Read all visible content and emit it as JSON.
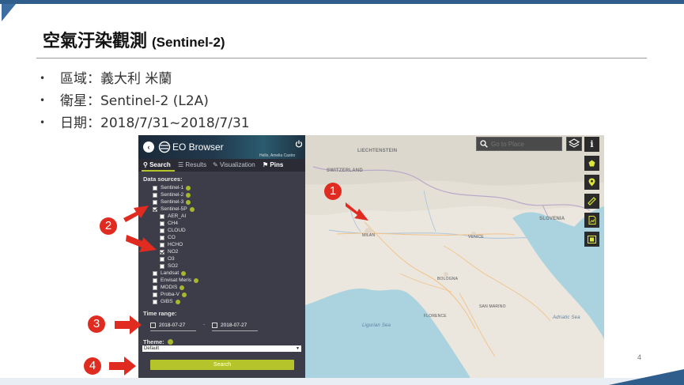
{
  "slide": {
    "title": "空氣汙染觀測",
    "title_sub": "(Sentinel-2)",
    "bullets": [
      "區域：義大利 米蘭",
      "衛星：Sentinel-2 (L2A)",
      "日期：2018/7/31~2018/7/31"
    ],
    "page_number": "4"
  },
  "annotations": [
    "1",
    "2",
    "3",
    "4"
  ],
  "eo_browser": {
    "brand": "EO Browser",
    "user": "Hello, Amelia Castro",
    "tabs": [
      "Search",
      "Results",
      "Visualization",
      "Pins"
    ],
    "data_sources_title": "Data sources:",
    "sources": [
      {
        "label": "Sentinel-1",
        "checked": false
      },
      {
        "label": "Sentinel-2",
        "checked": false
      },
      {
        "label": "Sentinel-3",
        "checked": false
      },
      {
        "label": "Sentinel-5P",
        "checked": true
      }
    ],
    "sub_sources": [
      {
        "label": "AER_AI",
        "checked": false
      },
      {
        "label": "CH4",
        "checked": false
      },
      {
        "label": "CLOUD",
        "checked": false
      },
      {
        "label": "CO",
        "checked": false
      },
      {
        "label": "HCHO",
        "checked": false
      },
      {
        "label": "NO2",
        "checked": true
      },
      {
        "label": "O3",
        "checked": false
      },
      {
        "label": "SO2",
        "checked": false
      }
    ],
    "more_sources": [
      {
        "label": "Landsat",
        "checked": false
      },
      {
        "label": "Envisat Meris",
        "checked": false
      },
      {
        "label": "MODIS",
        "checked": false
      },
      {
        "label": "Proba-V",
        "checked": false
      },
      {
        "label": "GIBS",
        "checked": false
      }
    ],
    "time_range_title": "Time range:",
    "date_from": "2018-07-27",
    "date_to": "2018-07-27",
    "theme_title": "Theme:",
    "theme_value": "Default",
    "search_button": "Search"
  },
  "map": {
    "goto_placeholder": "Go to Place",
    "labels": {
      "liechtenstein": "LIECHTENSTEIN",
      "switzerland": "SWITZERLAND",
      "slovenia": "SLOVENIA",
      "milan": "MILAN",
      "venice": "VENICE",
      "bologna": "BOLOGNA",
      "florence": "FLORENCE",
      "san_marino": "SAN MARINO",
      "adriatic": "Adriatic Sea",
      "ligurian": "Ligurian Sea"
    }
  },
  "colors": {
    "accent": "#b6c42b",
    "panel_bg": "#3c3d49",
    "annotation_red": "#e02b20",
    "slide_blue": "#2f5d8c"
  }
}
